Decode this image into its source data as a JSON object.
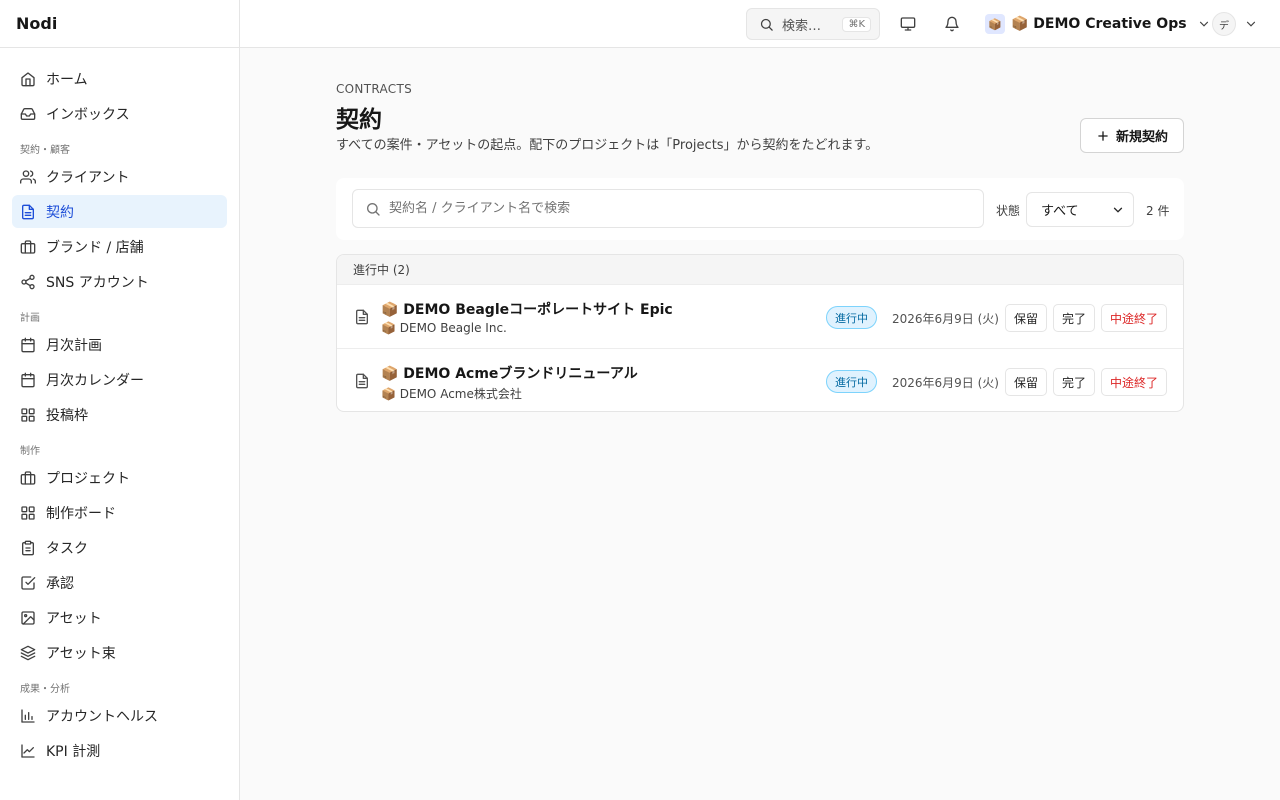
{
  "app": {
    "name": "Nodi"
  },
  "sidebar": {
    "items": [
      {
        "label": "ホーム",
        "icon": "home-icon"
      },
      {
        "label": "インボックス",
        "icon": "inbox-icon"
      }
    ],
    "sections": [
      {
        "title": "契約・顧客",
        "items": [
          {
            "label": "クライアント",
            "icon": "users-icon"
          },
          {
            "label": "契約",
            "icon": "file-text-icon",
            "active": true
          },
          {
            "label": "ブランド / 店舗",
            "icon": "briefcase-icon"
          },
          {
            "label": "SNS アカウント",
            "icon": "share-icon"
          }
        ]
      },
      {
        "title": "計画",
        "items": [
          {
            "label": "月次計画",
            "icon": "calendar-icon"
          },
          {
            "label": "月次カレンダー",
            "icon": "calendar-icon"
          },
          {
            "label": "投稿枠",
            "icon": "grid-icon"
          }
        ]
      },
      {
        "title": "制作",
        "items": [
          {
            "label": "プロジェクト",
            "icon": "briefcase-icon"
          },
          {
            "label": "制作ボード",
            "icon": "grid-icon"
          },
          {
            "label": "タスク",
            "icon": "clipboard-icon"
          },
          {
            "label": "承認",
            "icon": "check-square-icon"
          },
          {
            "label": "アセット",
            "icon": "image-icon"
          },
          {
            "label": "アセット束",
            "icon": "layers-icon"
          }
        ]
      },
      {
        "title": "成果・分析",
        "items": [
          {
            "label": "アカウントヘルス",
            "icon": "bar-chart-icon"
          },
          {
            "label": "KPI 計測",
            "icon": "line-chart-icon"
          }
        ]
      }
    ]
  },
  "topbar": {
    "search_label": "検索…",
    "search_shortcut": "⌘K",
    "workspace_emoji": "📦",
    "workspace_name": "📦 DEMO Creative Ops",
    "user_initial": "デ"
  },
  "page": {
    "eyebrow": "CONTRACTS",
    "title": "契約",
    "subtitle": "すべての案件・アセットの起点。配下のプロジェクトは「Projects」から契約をたどれます。",
    "new_button": "新規契約"
  },
  "filter": {
    "search_placeholder": "契約名 / クライアント名で検索",
    "state_label": "状態",
    "state_value": "すべて",
    "count": "2 件"
  },
  "list": {
    "group_label": "進行中 (2)",
    "rows": [
      {
        "name": "📦 DEMO Beagleコーポレートサイト Epic",
        "client": "📦 DEMO Beagle Inc.",
        "status": "進行中",
        "date": "2026年6月9日 (火)",
        "actions": {
          "hold": "保留",
          "done": "完了",
          "terminate": "中途終了"
        }
      },
      {
        "name": "📦 DEMO Acmeブランドリニューアル",
        "client": "📦 DEMO Acme株式会社",
        "status": "進行中",
        "date": "2026年6月9日 (火)",
        "actions": {
          "hold": "保留",
          "done": "完了",
          "terminate": "中途終了"
        }
      }
    ]
  },
  "colors": {
    "accent": "#1d4ed8",
    "active_bg": "#e8f3fd",
    "badge_bg": "#e0f2fe",
    "badge_text": "#0369a1",
    "danger": "#dc2626"
  }
}
